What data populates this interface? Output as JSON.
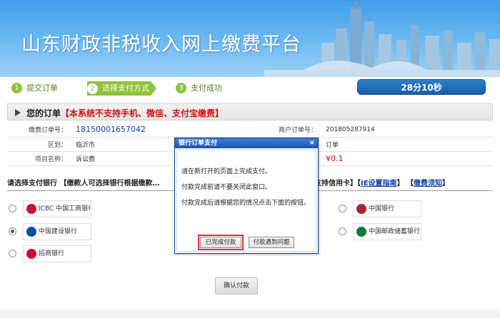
{
  "banner": {
    "title": "山东财政非税收入网上缴费平台"
  },
  "steps": [
    {
      "num": "1",
      "label": "提交订单"
    },
    {
      "num": "2",
      "label": "选择支付方式"
    },
    {
      "num": "3",
      "label": "支付成功"
    }
  ],
  "timer": "28分10秒",
  "order": {
    "header_title": "您的订单",
    "header_notice": "【本系统不支持手机、微信、支付宝缴费】",
    "rows": {
      "payment_no_label": "缴费订单号：",
      "payment_no": "1815000165704​2",
      "merchant_no_label": "商户订单号：",
      "merchant_no": "201805287914",
      "region_label": "区划：",
      "region": "临沂市",
      "project_label": "项目名称：",
      "project": "诉讼费",
      "amount": "¥0.1",
      "right_fragment": "订单"
    }
  },
  "bank_section": {
    "prompt": "请选择支付银行",
    "hint": "【缴款人可选择银行根据缴款…",
    "credit_note": "不支持信用卡】",
    "link_ie": "IE设置指南",
    "link_guide": "缴费须知"
  },
  "banks": [
    {
      "name": "ICBC 中国工商银行",
      "color": "#c8102e",
      "checked": false
    },
    {
      "name": "中国建设银行",
      "color": "#0a4fa0",
      "checked": true
    },
    {
      "name": "招商银行",
      "color": "#c8102e",
      "checked": false
    },
    {
      "name": "中国银行",
      "color": "#a8262d",
      "checked": false
    },
    {
      "name": "中国邮政储蓄银行",
      "color": "#0b7a3b",
      "checked": false
    }
  ],
  "confirm_button": "确认付款",
  "dialog": {
    "title": "银行订单支付",
    "close": "×",
    "line1": "请在新打开的页面上完成支付。",
    "line2": "付款完成前请不要关闭此窗口。",
    "line3": "付款完成后请根据您的情况点击下面的按钮。",
    "btn_done": "已完成付款",
    "btn_problem": "付款遇到问题"
  },
  "colors": {
    "banner": "#4aa6ec",
    "step_active": "#8fc23a",
    "timer": "#1f66b0",
    "notice": "#d01010"
  }
}
